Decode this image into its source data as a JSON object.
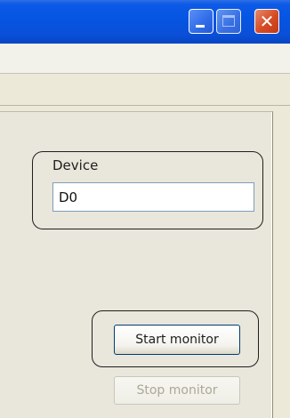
{
  "titlebar": {
    "minimize_icon": "minimize-icon",
    "maximize_icon": "maximize-icon",
    "close_icon": "close-icon",
    "close_glyph": "✕"
  },
  "device": {
    "label": "Device",
    "value": "D0"
  },
  "buttons": {
    "start_label": "Start monitor",
    "stop_label": "Stop monitor",
    "stop_enabled": false
  },
  "colors": {
    "titlebar": "#0655e3",
    "close_button": "#d64a23",
    "window_bg": "#ece9d8",
    "disabled_text": "#aca899"
  }
}
